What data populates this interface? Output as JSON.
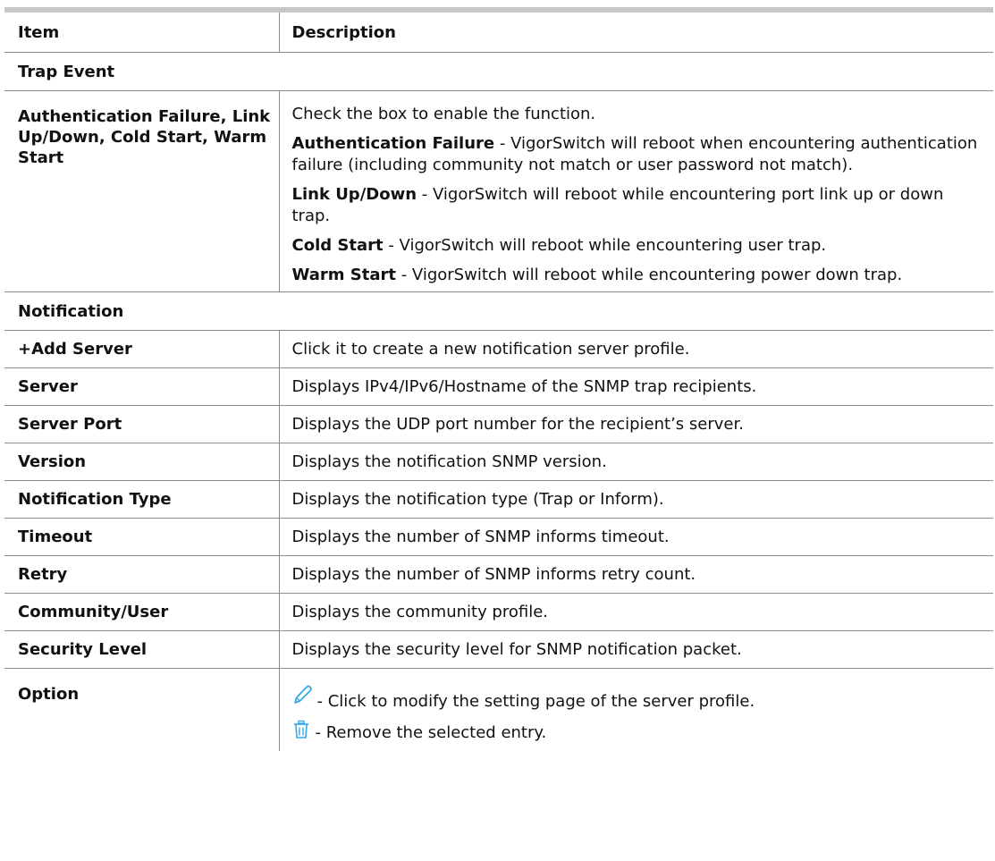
{
  "header": {
    "item": "Item",
    "description": "Description"
  },
  "sections": {
    "trap_event": "Trap Event",
    "notification": "Notification"
  },
  "trap_row": {
    "item": "Authentication Failure, Link Up/Down, Cold Start, Warm Start",
    "intro": "Check the box to enable the function.",
    "entries": [
      {
        "term": "Authentication Failure",
        "text": " - VigorSwitch will reboot when encountering authentication failure (including community not match or user password not match)."
      },
      {
        "term": "Link Up/Down",
        "text": " - VigorSwitch will reboot while encountering port link up or down trap."
      },
      {
        "term": "Cold Start",
        "text": " - VigorSwitch will reboot while encountering user trap."
      },
      {
        "term": "Warm Start",
        "text": " - VigorSwitch will reboot while encountering power down trap."
      }
    ]
  },
  "rows": [
    {
      "item": "+Add Server",
      "desc": "Click it to create a new notification server profile."
    },
    {
      "item": "Server",
      "desc": "Displays IPv4/IPv6/Hostname of the SNMP trap recipients."
    },
    {
      "item": "Server Port",
      "desc": "Displays the UDP port number for the recipient’s server."
    },
    {
      "item": "Version",
      "desc": "Displays the notification SNMP version."
    },
    {
      "item": "Notification Type",
      "desc": "Displays the notification type (Trap or Inform)."
    },
    {
      "item": "Timeout",
      "desc": "Displays the number of SNMP informs timeout."
    },
    {
      "item": "Retry",
      "desc": "Displays the number of SNMP informs retry count."
    },
    {
      "item": "Community/User",
      "desc": "Displays the community profile."
    },
    {
      "item": "Security Level",
      "desc": "Displays the security level for SNMP notification packet."
    }
  ],
  "option_row": {
    "item": "Option",
    "edit_text": " - Click to modify the setting page of the server profile.",
    "remove_text": " - Remove the selected entry.",
    "edit_icon": "pencil-icon",
    "remove_icon": "trash-icon"
  },
  "colors": {
    "icon_blue": "#3aa7e6",
    "rule_gray": "#c7c7c7",
    "border": "#8c8c8c"
  }
}
